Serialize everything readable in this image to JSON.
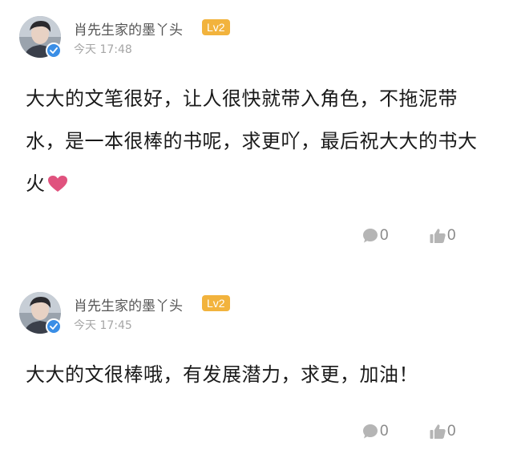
{
  "comments": [
    {
      "username": "肖先生家的墨丫头",
      "level": "Lv2",
      "time": "今天 17:48",
      "text": "大大的文笔很好，让人很快就带入角色，不拖泥带水，是一本很棒的书呢，求更吖，最后祝大大的书大火",
      "reply_count": "0",
      "like_count": "0"
    },
    {
      "username": "肖先生家的墨丫头",
      "level": "Lv2",
      "time": "今天 17:45",
      "text": "大大的文很棒哦，有发展潜力，求更，加油！",
      "reply_count": "0",
      "like_count": "0"
    }
  ],
  "colors": {
    "level_badge": "#f2b33d",
    "verified_badge": "#3a8ee6",
    "heart": "#e0527e",
    "icon_gray": "#b5b5b5"
  },
  "icons": [
    "verified-icon",
    "heart-icon",
    "comment-icon",
    "thumbs-up-icon"
  ]
}
